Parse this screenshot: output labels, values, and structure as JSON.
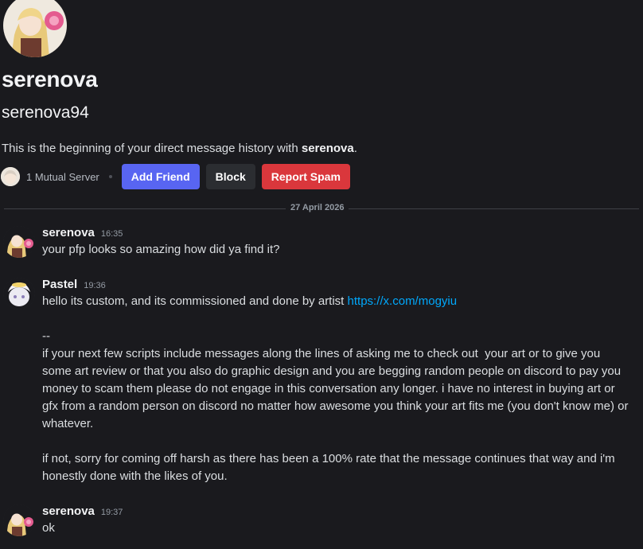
{
  "profile": {
    "display_name": "serenova",
    "username": "serenova94",
    "intro_prefix": "This is the beginning of your direct message history with ",
    "intro_name": "serenova",
    "intro_suffix": "."
  },
  "actions": {
    "mutual_servers": "1 Mutual Server",
    "add_friend": "Add Friend",
    "block": "Block",
    "report_spam": "Report Spam"
  },
  "date_divider": "27 April 2026",
  "messages": [
    {
      "author": "serenova",
      "time": "16:35",
      "text": "your pfp looks so amazing how did ya find it?",
      "avatar_icon": "serenova-avatar"
    },
    {
      "author": "Pastel",
      "time": "19:36",
      "text_prefix": "hello its custom, and its commissioned and done by artist ",
      "link": "https://x.com/mogyiu",
      "separator": "--",
      "paragraph_1": "if your next few scripts include messages along the lines of asking me to check out  your art or to give you some art review or that you also do graphic design and you are begging random people on discord to pay you money to scam them please do not engage in this conversation any longer. i have no interest in buying art or gfx from a random person on discord no matter how awesome you think your art fits me (you don't know me) or whatever.",
      "paragraph_2": "if not, sorry for coming off harsh as there has been a 100% rate that the message continues that way and i'm honestly done with the likes of you.",
      "avatar_icon": "pastel-avatar"
    },
    {
      "author": "serenova",
      "time": "19:37",
      "text": "ok",
      "avatar_icon": "serenova-avatar"
    }
  ],
  "colors": {
    "background": "#1a1a1e",
    "primary_button": "#5865f2",
    "secondary_button": "#2b2d31",
    "danger_button": "#da373c",
    "link": "#00a8fc"
  }
}
